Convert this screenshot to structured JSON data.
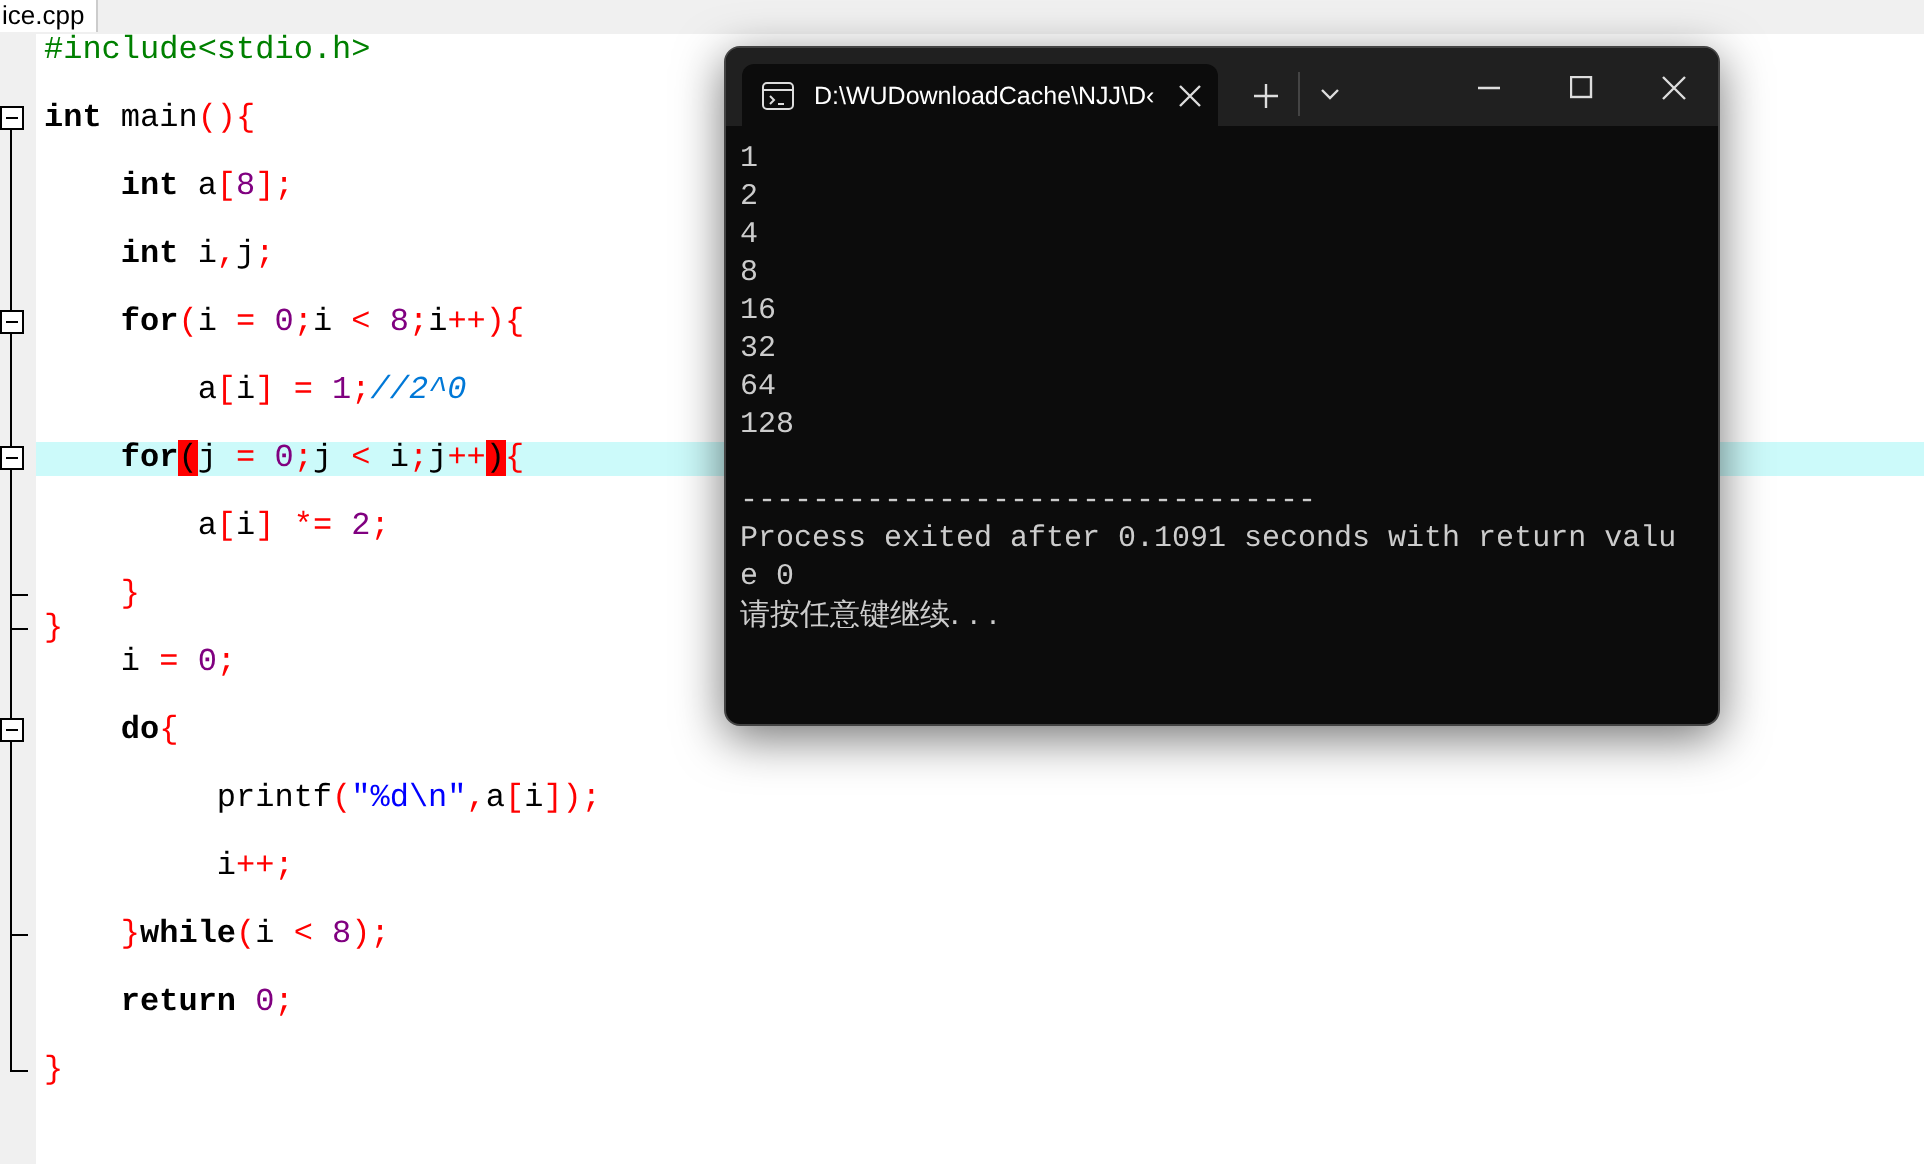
{
  "editor": {
    "tab": {
      "label": "ice.cpp"
    },
    "lines": [
      {
        "kind": "code",
        "tokens": [
          {
            "kind": "preproc",
            "text": "#include<stdio.h>"
          }
        ]
      },
      {
        "kind": "blank"
      },
      {
        "kind": "code",
        "expanded": true,
        "tokens": [
          {
            "kind": "keyword",
            "text": "int"
          },
          {
            "kind": "plain",
            "text": " main"
          },
          {
            "kind": "op",
            "text": "(){"
          }
        ]
      },
      {
        "kind": "blank"
      },
      {
        "kind": "code",
        "tokens": [
          {
            "kind": "keyword",
            "text": "    int"
          },
          {
            "kind": "plain",
            "text": " a"
          },
          {
            "kind": "op",
            "text": "["
          },
          {
            "kind": "number",
            "text": "8"
          },
          {
            "kind": "op",
            "text": "];"
          }
        ]
      },
      {
        "kind": "blank"
      },
      {
        "kind": "code",
        "tokens": [
          {
            "kind": "keyword",
            "text": "    int"
          },
          {
            "kind": "plain",
            "text": " i"
          },
          {
            "kind": "op",
            "text": ","
          },
          {
            "kind": "plain",
            "text": "j"
          },
          {
            "kind": "op",
            "text": ";"
          }
        ]
      },
      {
        "kind": "blank"
      },
      {
        "kind": "code",
        "expanded": true,
        "tokens": [
          {
            "kind": "keyword",
            "text": "    for"
          },
          {
            "kind": "op",
            "text": "("
          },
          {
            "kind": "plain",
            "text": "i "
          },
          {
            "kind": "op",
            "text": "="
          },
          {
            "kind": "number",
            "text": " 0"
          },
          {
            "kind": "op",
            "text": ";"
          },
          {
            "kind": "plain",
            "text": "i "
          },
          {
            "kind": "op",
            "text": "<"
          },
          {
            "kind": "number",
            "text": " 8"
          },
          {
            "kind": "op",
            "text": ";"
          },
          {
            "kind": "plain",
            "text": "i"
          },
          {
            "kind": "op",
            "text": "++){"
          }
        ]
      },
      {
        "kind": "blank"
      },
      {
        "kind": "code",
        "tokens": [
          {
            "kind": "plain",
            "text": "        a"
          },
          {
            "kind": "op",
            "text": "["
          },
          {
            "kind": "plain",
            "text": "i"
          },
          {
            "kind": "op",
            "text": "] ="
          },
          {
            "kind": "number",
            "text": " 1"
          },
          {
            "kind": "op",
            "text": ";"
          },
          {
            "kind": "comment",
            "text": "//2^0"
          }
        ]
      },
      {
        "kind": "blank"
      },
      {
        "kind": "code",
        "expanded": true,
        "highlighted": true,
        "tokens": [
          {
            "kind": "keyword",
            "text": "    for"
          },
          {
            "kind": "match",
            "text": "("
          },
          {
            "kind": "plain",
            "text": "j "
          },
          {
            "kind": "op",
            "text": "="
          },
          {
            "kind": "number",
            "text": " 0"
          },
          {
            "kind": "op",
            "text": ";"
          },
          {
            "kind": "plain",
            "text": "j "
          },
          {
            "kind": "op",
            "text": "<"
          },
          {
            "kind": "plain",
            "text": " i"
          },
          {
            "kind": "op",
            "text": ";"
          },
          {
            "kind": "plain",
            "text": "j"
          },
          {
            "kind": "op",
            "text": "++"
          },
          {
            "kind": "match",
            "text": ")"
          },
          {
            "kind": "op",
            "text": "{"
          }
        ]
      },
      {
        "kind": "blank"
      },
      {
        "kind": "code",
        "tokens": [
          {
            "kind": "plain",
            "text": "        a"
          },
          {
            "kind": "op",
            "text": "["
          },
          {
            "kind": "plain",
            "text": "i"
          },
          {
            "kind": "op",
            "text": "] *="
          },
          {
            "kind": "number",
            "text": " 2"
          },
          {
            "kind": "op",
            "text": ";"
          }
        ]
      },
      {
        "kind": "blank"
      },
      {
        "kind": "code",
        "closes_block": true,
        "tokens": [
          {
            "kind": "op",
            "text": "    }"
          }
        ]
      },
      {
        "kind": "code",
        "closes_block": true,
        "tokens": [
          {
            "kind": "op",
            "text": "}"
          }
        ]
      },
      {
        "kind": "code",
        "tokens": [
          {
            "kind": "plain",
            "text": "    i "
          },
          {
            "kind": "op",
            "text": "="
          },
          {
            "kind": "number",
            "text": " 0"
          },
          {
            "kind": "op",
            "text": ";"
          }
        ]
      },
      {
        "kind": "blank"
      },
      {
        "kind": "code",
        "expanded": true,
        "tokens": [
          {
            "kind": "keyword",
            "text": "    do"
          },
          {
            "kind": "op",
            "text": "{"
          }
        ]
      },
      {
        "kind": "blank"
      },
      {
        "kind": "code",
        "tokens": [
          {
            "kind": "plain",
            "text": "         printf"
          },
          {
            "kind": "op",
            "text": "("
          },
          {
            "kind": "string",
            "text": "\"%d\\n\""
          },
          {
            "kind": "op",
            "text": ","
          },
          {
            "kind": "plain",
            "text": "a"
          },
          {
            "kind": "op",
            "text": "["
          },
          {
            "kind": "plain",
            "text": "i"
          },
          {
            "kind": "op",
            "text": "]);"
          }
        ]
      },
      {
        "kind": "blank"
      },
      {
        "kind": "code",
        "tokens": [
          {
            "kind": "plain",
            "text": "         i"
          },
          {
            "kind": "op",
            "text": "++;"
          }
        ]
      },
      {
        "kind": "blank"
      },
      {
        "kind": "code",
        "closes_block": true,
        "tokens": [
          {
            "kind": "op",
            "text": "    }"
          },
          {
            "kind": "keyword",
            "text": "while"
          },
          {
            "kind": "op",
            "text": "("
          },
          {
            "kind": "plain",
            "text": "i "
          },
          {
            "kind": "op",
            "text": "<"
          },
          {
            "kind": "number",
            "text": " 8"
          },
          {
            "kind": "op",
            "text": ");"
          }
        ]
      },
      {
        "kind": "blank"
      },
      {
        "kind": "code",
        "tokens": [
          {
            "kind": "keyword",
            "text": "    return"
          },
          {
            "kind": "number",
            "text": " 0"
          },
          {
            "kind": "op",
            "text": ";"
          }
        ]
      },
      {
        "kind": "blank"
      },
      {
        "kind": "code",
        "closes_block": true,
        "tokens": [
          {
            "kind": "op",
            "text": "}"
          }
        ]
      }
    ]
  },
  "terminal": {
    "tab_title": "D:\\WUDownloadCache\\NJJ\\D‹",
    "output": [
      {
        "kind": "text",
        "text": "1"
      },
      {
        "kind": "text",
        "text": "2"
      },
      {
        "kind": "text",
        "text": "4"
      },
      {
        "kind": "text",
        "text": "8"
      },
      {
        "kind": "text",
        "text": "16"
      },
      {
        "kind": "text",
        "text": "32"
      },
      {
        "kind": "text",
        "text": "64"
      },
      {
        "kind": "text",
        "text": "128"
      },
      {
        "kind": "blank"
      },
      {
        "kind": "text",
        "text": "--------------------------------"
      },
      {
        "kind": "text",
        "text": "Process exited after 0.1091 seconds with return valu"
      },
      {
        "kind": "text",
        "text": "e 0"
      },
      {
        "kind": "text",
        "text": "请按任意键继续. . ."
      }
    ]
  }
}
